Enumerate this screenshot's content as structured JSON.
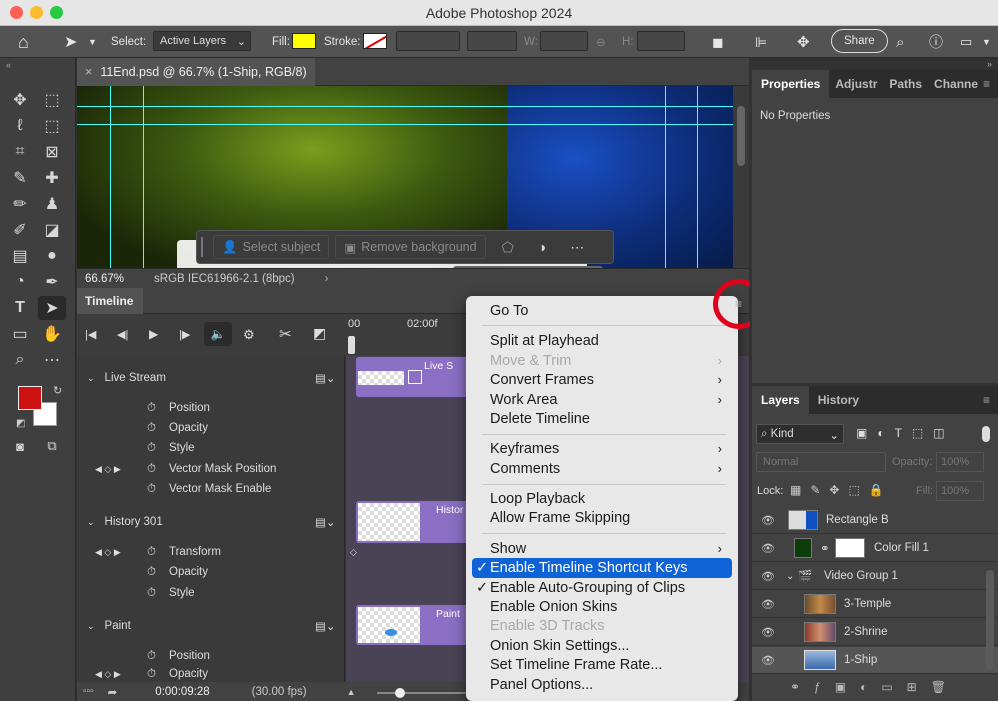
{
  "window": {
    "title": "Adobe Photoshop 2024"
  },
  "options_bar": {
    "select_label": "Select:",
    "select_value": "Active Layers",
    "fill_label": "Fill:",
    "fill_color": "#ffff00",
    "stroke_label": "Stroke:",
    "w_label": "W:",
    "h_label": "H:",
    "share_label": "Share"
  },
  "document": {
    "tab_title": "11End.psd @ 66.7% (1-Ship, RGB/8)",
    "close_glyph": "×",
    "zoom": "66.67%",
    "color_profile": "sRGB IEC61966-2.1 (8bpc)"
  },
  "contextual_bar": {
    "select_subject": "Select subject",
    "remove_background": "Remove background"
  },
  "timeline": {
    "panel_title": "Timeline",
    "ruler": [
      "00",
      "02:00f"
    ],
    "tracks": [
      {
        "name": "Live Stream",
        "props": [
          "Position",
          "Opacity",
          "Style",
          "Vector Mask Position",
          "Vector Mask Enable"
        ],
        "clip_label": "Live S"
      },
      {
        "name": "History 301",
        "props": [
          "Transform",
          "Opacity",
          "Style"
        ],
        "clip_label": "Histor"
      },
      {
        "name": "Paint",
        "props": [
          "Position",
          "Opacity"
        ],
        "clip_label": "Paint"
      }
    ],
    "timecode": "0:00:09:28",
    "fps": "(30.00 fps)"
  },
  "menu": {
    "items": [
      {
        "label": "Go To",
        "disabled": false,
        "submenu": false
      },
      {
        "label": "Split at Playhead",
        "disabled": false,
        "submenu": false
      },
      {
        "label": "Move & Trim",
        "disabled": true,
        "submenu": true
      },
      {
        "label": "Convert Frames",
        "disabled": false,
        "submenu": true
      },
      {
        "label": "Work Area",
        "disabled": false,
        "submenu": true
      },
      {
        "label": "Delete Timeline",
        "disabled": false,
        "submenu": false
      },
      {
        "label": "Keyframes",
        "disabled": false,
        "submenu": true
      },
      {
        "label": "Comments",
        "disabled": false,
        "submenu": true
      },
      {
        "label": "Loop Playback",
        "disabled": false,
        "submenu": false
      },
      {
        "label": "Allow Frame Skipping",
        "disabled": false,
        "submenu": false
      },
      {
        "label": "Show",
        "disabled": false,
        "submenu": true
      },
      {
        "label": "Enable Timeline Shortcut Keys",
        "disabled": false,
        "submenu": false,
        "checked": true,
        "highlighted": true
      },
      {
        "label": "Enable Auto-Grouping of Clips",
        "disabled": false,
        "submenu": false,
        "checked": true
      },
      {
        "label": "Enable Onion Skins",
        "disabled": false,
        "submenu": false
      },
      {
        "label": "Enable 3D Tracks",
        "disabled": true,
        "submenu": false
      },
      {
        "label": "Onion Skin Settings...",
        "disabled": false,
        "submenu": false
      },
      {
        "label": "Set Timeline Frame Rate...",
        "disabled": false,
        "submenu": false
      },
      {
        "label": "Panel Options...",
        "disabled": false,
        "submenu": false
      }
    ]
  },
  "properties_panel": {
    "tabs": [
      "Properties",
      "Adjustr",
      "Paths",
      "Channe"
    ],
    "body_text": "No Properties"
  },
  "layers_panel": {
    "tabs": [
      "Layers",
      "History"
    ],
    "filter_kind": "Kind",
    "blend_mode": "Normal",
    "opacity_label": "Opacity:",
    "opacity_value": "100%",
    "lock_label": "Lock:",
    "fill_label": "Fill:",
    "fill_value": "100%",
    "layers": [
      {
        "name": "Rectangle B"
      },
      {
        "name": "Color Fill 1"
      },
      {
        "name": "Video Group 1"
      },
      {
        "name": "3-Temple"
      },
      {
        "name": "2-Shrine"
      },
      {
        "name": "1-Ship"
      }
    ]
  },
  "colors": {
    "foreground": "#cc1111",
    "background": "#ffffff",
    "accent": "#1063d6",
    "highlight_ring": "#e0001b",
    "clip": "#8a6fc4"
  }
}
